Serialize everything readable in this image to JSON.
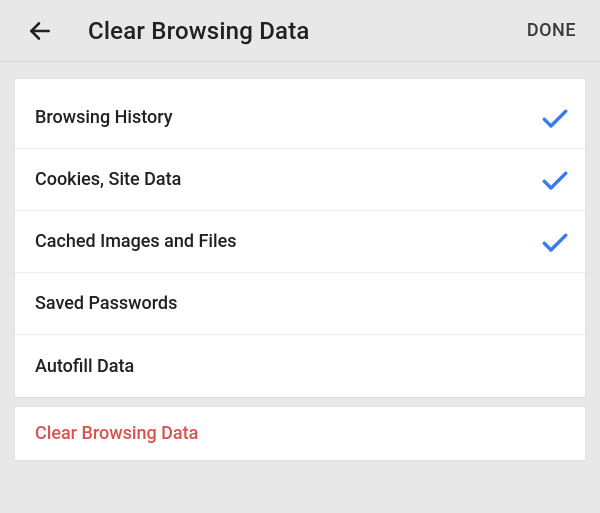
{
  "header": {
    "title": "Clear Browsing Data",
    "done": "DONE"
  },
  "items": [
    {
      "label": "Browsing History",
      "checked": true
    },
    {
      "label": "Cookies, Site Data",
      "checked": true
    },
    {
      "label": "Cached Images and Files",
      "checked": true
    },
    {
      "label": "Saved Passwords",
      "checked": false
    },
    {
      "label": "Autofill Data",
      "checked": false
    }
  ],
  "action": {
    "label": "Clear Browsing Data"
  },
  "colors": {
    "accent": "#4285F4",
    "danger": "#d9534f"
  }
}
